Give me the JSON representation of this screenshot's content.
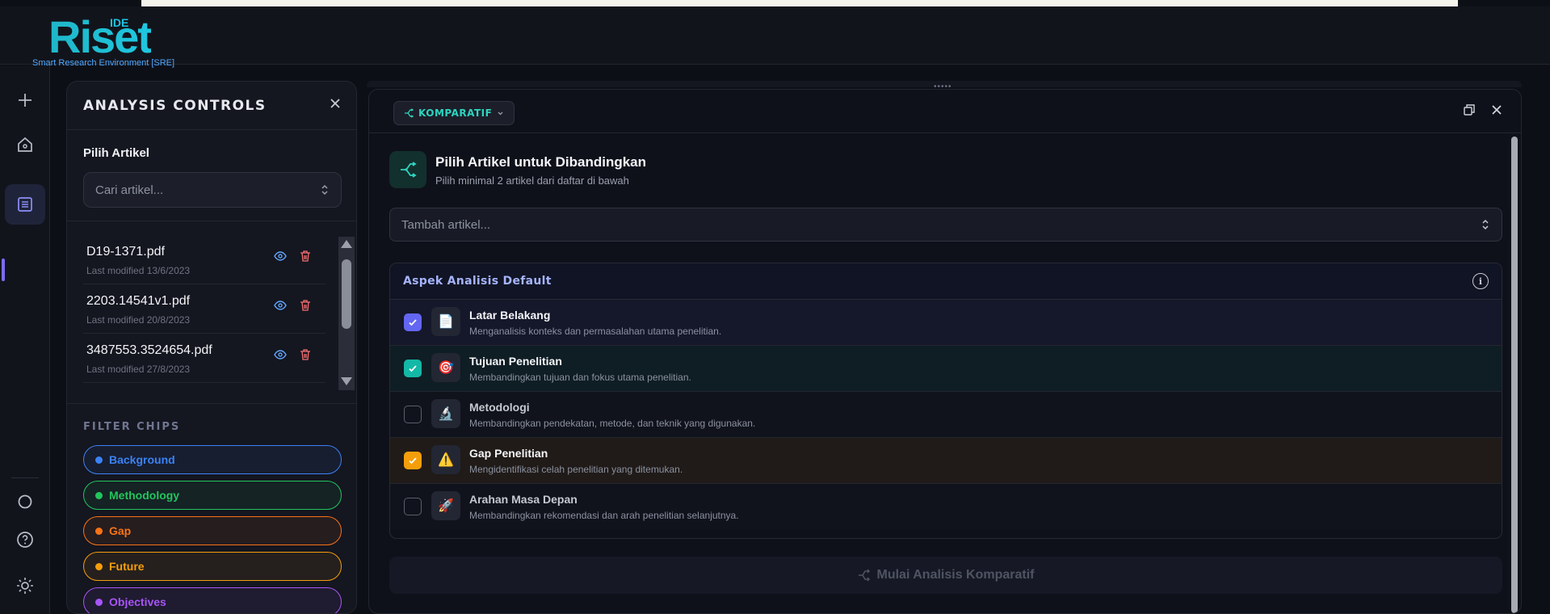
{
  "app": {
    "logo_ide": "IDE",
    "logo_name": "Riset",
    "logo_subtitle": "Smart Research Environment [SRE]"
  },
  "rail": {
    "items": [
      "new",
      "home",
      "documents",
      "circle",
      "help",
      "theme"
    ]
  },
  "controls": {
    "title": "ANALYSIS CONTROLS",
    "pick_label": "Pilih Artikel",
    "search_placeholder": "Cari artikel...",
    "files": [
      {
        "name": "D19-1371.pdf",
        "modified": "Last modified 13/6/2023"
      },
      {
        "name": "2203.14541v1.pdf",
        "modified": "Last modified 20/8/2023"
      },
      {
        "name": "3487553.3524654.pdf",
        "modified": "Last modified 27/8/2023"
      }
    ],
    "filter_label": "FILTER CHIPS",
    "chips": [
      {
        "label": "Background",
        "color": "#3b82f6"
      },
      {
        "label": "Methodology",
        "color": "#22c55e"
      },
      {
        "label": "Gap",
        "color": "#f97316"
      },
      {
        "label": "Future",
        "color": "#f59e0b"
      },
      {
        "label": "Objectives",
        "color": "#a855f7"
      }
    ]
  },
  "main": {
    "mode_label": "KOMPARATIF",
    "hero_title": "Pilih Artikel untuk Dibandingkan",
    "hero_subtitle": "Pilih minimal 2 artikel dari daftar di bawah",
    "add_placeholder": "Tambah artikel...",
    "aspects_title": "Aspek Analisis Default",
    "aspects": [
      {
        "title": "Latar Belakang",
        "desc": "Menganalisis konteks dan permasalahan utama penelitian.",
        "checked": true,
        "icon": "📄",
        "accent": "#6366f1"
      },
      {
        "title": "Tujuan Penelitian",
        "desc": "Membandingkan tujuan dan fokus utama penelitian.",
        "checked": true,
        "icon": "🎯",
        "accent": "#14b8a6"
      },
      {
        "title": "Metodologi",
        "desc": "Membandingkan pendekatan, metode, dan teknik yang digunakan.",
        "checked": false,
        "icon": "🔬",
        "accent": ""
      },
      {
        "title": "Gap Penelitian",
        "desc": "Mengidentifikasi celah penelitian yang ditemukan.",
        "checked": true,
        "icon": "⚠️",
        "accent": "#f59e0b"
      },
      {
        "title": "Arahan Masa Depan",
        "desc": "Membandingkan rekomendasi dan arah penelitian selanjutnya.",
        "checked": false,
        "icon": "🚀",
        "accent": ""
      }
    ],
    "start_label": "Mulai Analisis Komparatif"
  }
}
